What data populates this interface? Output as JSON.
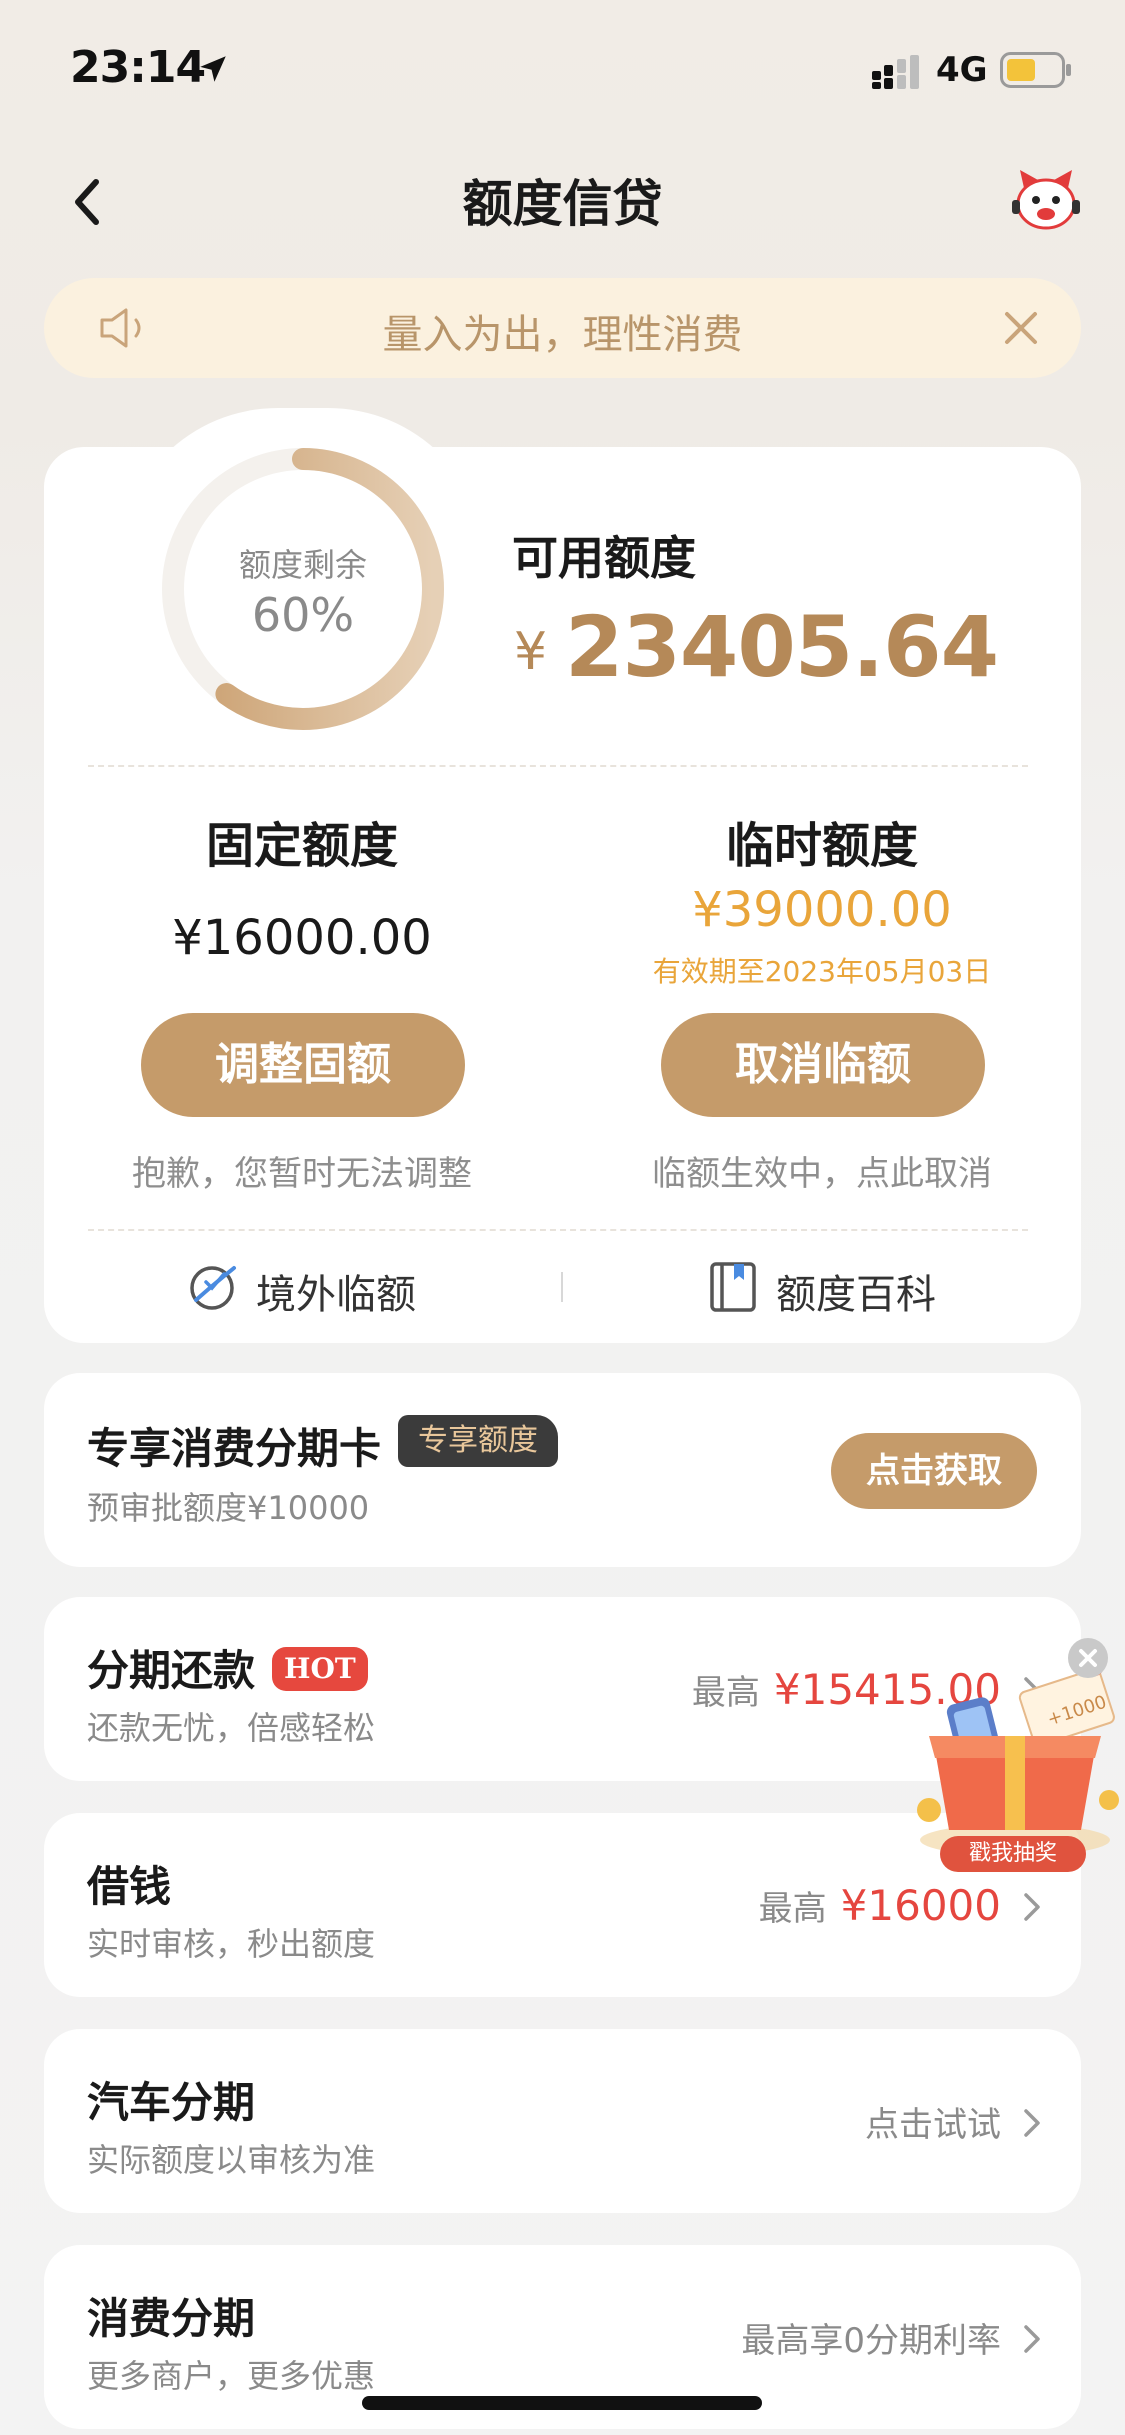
{
  "status_bar": {
    "time": "23:14",
    "network": "4G"
  },
  "nav": {
    "title": "额度信贷"
  },
  "notice": {
    "text": "量入为出，理性消费"
  },
  "credit": {
    "ring_label": "额度剩余",
    "ring_percent_text": "60%",
    "ring_fraction": 0.6,
    "available_title": "可用额度",
    "currency": "¥",
    "available_amount": "23405.64",
    "fixed": {
      "title": "固定额度",
      "amount": "¥16000.00",
      "button": "调整固额",
      "hint": "抱歉，您暂时无法调整"
    },
    "temporary": {
      "title": "临时额度",
      "amount": "¥39000.00",
      "valid_until": "有效期至2023年05月03日",
      "button": "取消临额",
      "hint": "临额生效中，点此取消"
    },
    "links": {
      "overseas": "境外临额",
      "wiki": "额度百科"
    }
  },
  "cards": {
    "installment_card": {
      "title": "专享消费分期卡",
      "badge": "专享额度",
      "subtitle": "预审批额度¥10000",
      "button": "点击获取"
    },
    "repayment": {
      "title": "分期还款",
      "badge": "HOT",
      "subtitle": "还款无忧，倍感轻松",
      "prefix": "最高",
      "amount": "¥15415.00"
    },
    "borrow": {
      "title": "借钱",
      "subtitle": "实时审核，秒出额度",
      "prefix": "最高",
      "amount": "¥16000"
    },
    "car": {
      "title": "汽车分期",
      "subtitle": "实际额度以审核为准",
      "action": "点击试试"
    },
    "consume": {
      "title": "消费分期",
      "subtitle": "更多商户，更多优惠",
      "action": "最高享0分期利率"
    }
  },
  "promo": {
    "label": "戳我抽奖",
    "coupon": "+1000"
  },
  "colors": {
    "accent": "#c59b6a",
    "gold_text": "#b58958",
    "temp_orange": "#e9a53a",
    "red": "#e5463f"
  }
}
